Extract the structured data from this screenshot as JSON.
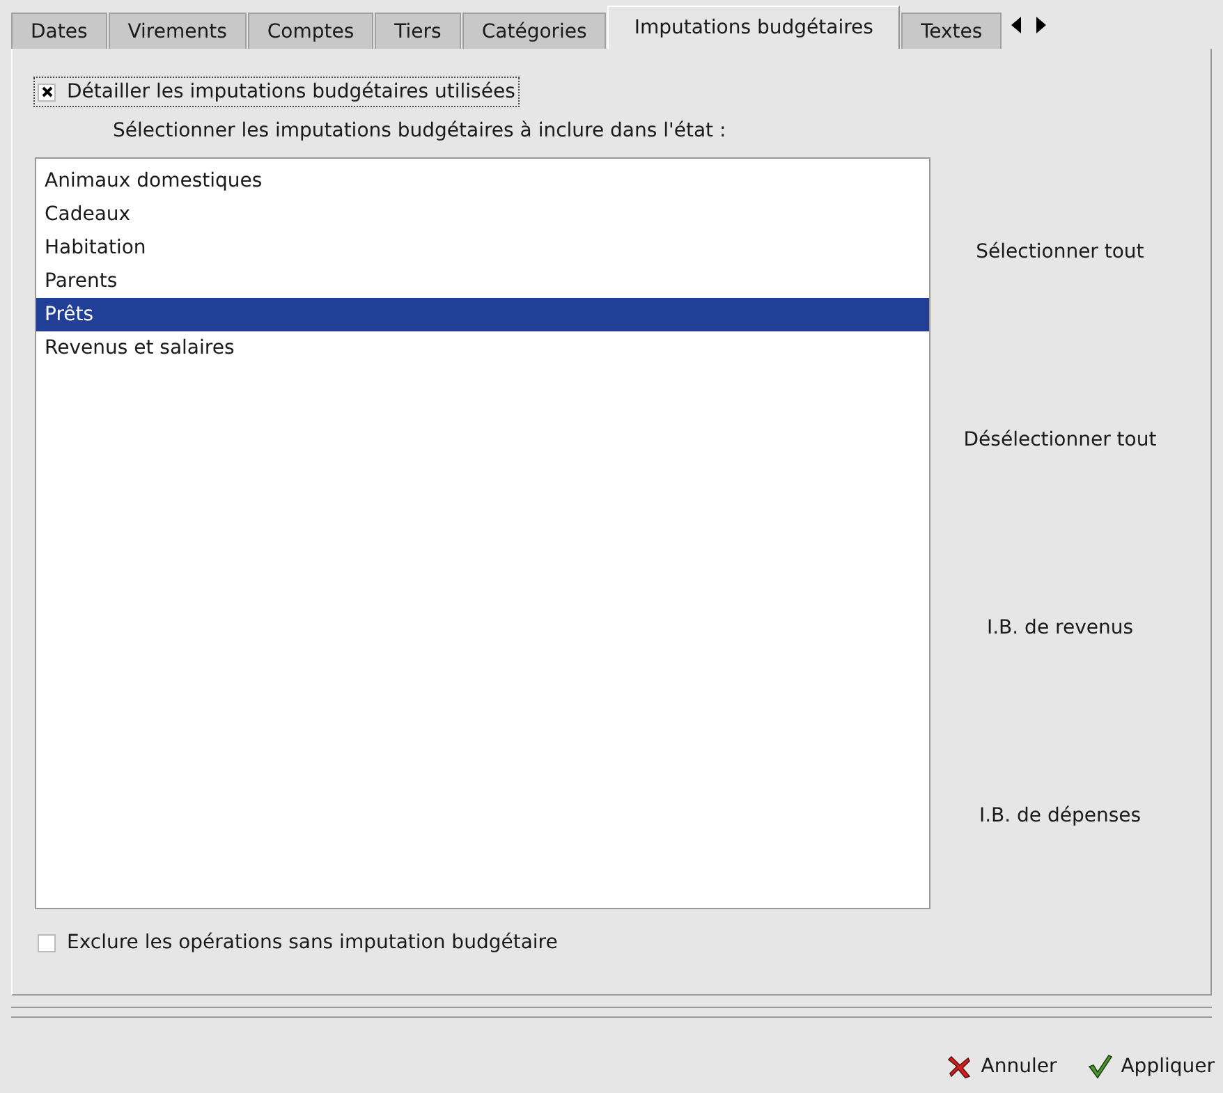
{
  "tabs": [
    {
      "label": "Dates",
      "selected": false
    },
    {
      "label": "Virements",
      "selected": false
    },
    {
      "label": "Comptes",
      "selected": false
    },
    {
      "label": "Tiers",
      "selected": false
    },
    {
      "label": "Catégories",
      "selected": false
    },
    {
      "label": "Imputations budgétaires",
      "selected": true
    },
    {
      "label": "Textes",
      "selected": false
    }
  ],
  "detail_checkbox": {
    "label": "Détailler les imputations budgétaires utilisées",
    "checked": true
  },
  "list_caption": "Sélectionner les imputations budgétaires à inclure dans l'état :",
  "items": [
    {
      "label": "Animaux domestiques",
      "selected": false
    },
    {
      "label": "Cadeaux",
      "selected": false
    },
    {
      "label": "Habitation",
      "selected": false
    },
    {
      "label": "Parents",
      "selected": false
    },
    {
      "label": "Prêts",
      "selected": true
    },
    {
      "label": "Revenus et salaires",
      "selected": false
    }
  ],
  "side_buttons": [
    "Sélectionner tout",
    "Désélectionner tout",
    "I.B. de revenus",
    "I.B. de dépenses"
  ],
  "exclude_checkbox": {
    "label": "Exclure les opérations sans imputation budgétaire",
    "checked": false
  },
  "buttons": [
    {
      "kind": "cancel",
      "label": "Annuler"
    },
    {
      "kind": "apply",
      "label": "Appliquer"
    }
  ]
}
